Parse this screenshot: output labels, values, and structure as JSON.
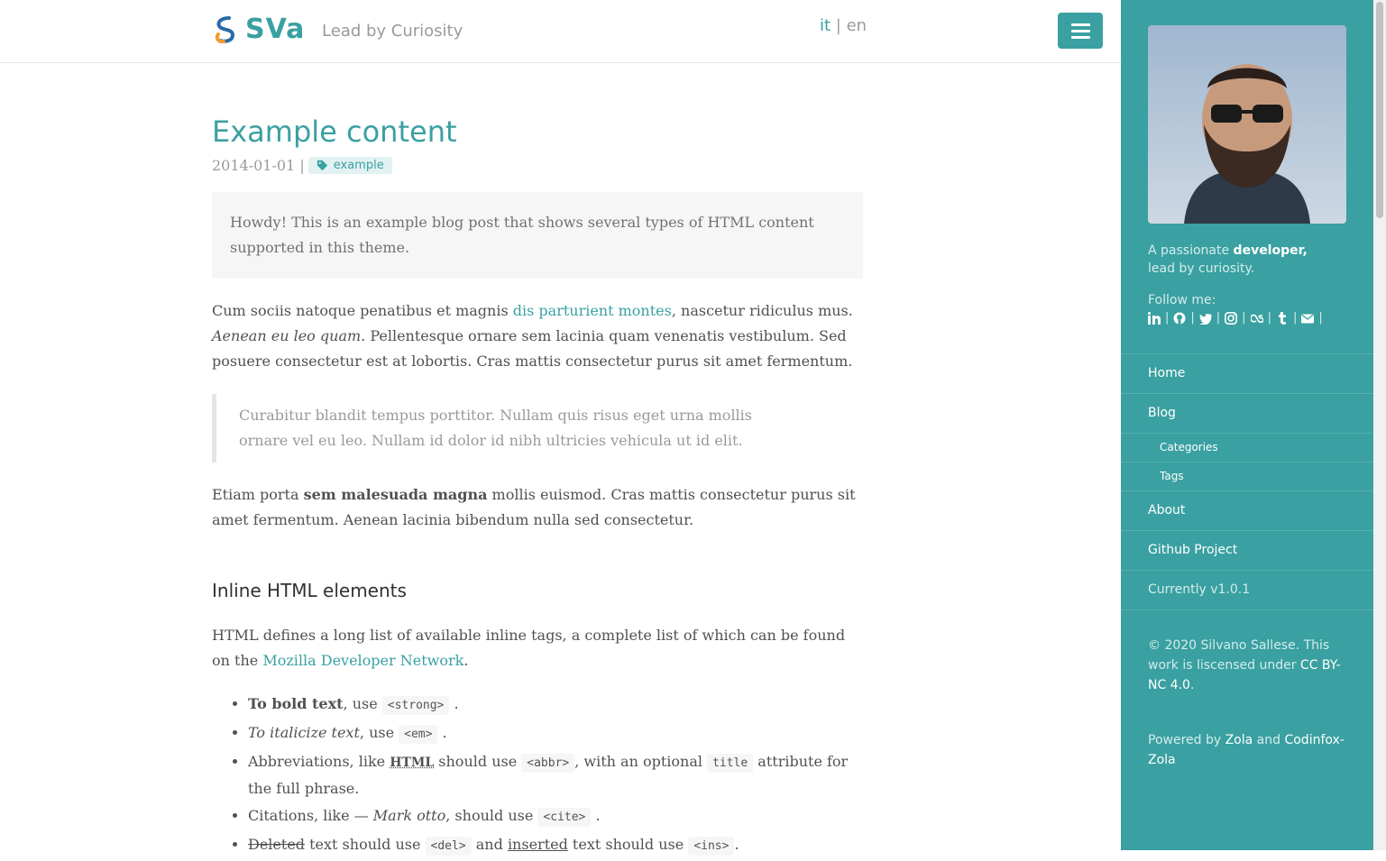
{
  "header": {
    "logo_text": "SVa",
    "tagline": "Lead by Curiosity",
    "lang_it": "it",
    "lang_sep": "|",
    "lang_en": "en"
  },
  "post": {
    "title": "Example content",
    "date": "2014-01-01",
    "meta_sep": "|",
    "tag": "example",
    "intro": "Howdy! This is an example blog post that shows several types of HTML content supported in this theme.",
    "p1_a": "Cum sociis natoque penatibus et magnis ",
    "p1_link": "dis parturient montes",
    "p1_b": ", nascetur ridiculus mus. ",
    "p1_em": "Aenean eu leo quam.",
    "p1_c": " Pellentesque ornare sem lacinia quam venenatis vestibulum. Sed posuere consectetur est at lobortis. Cras mattis consectetur purus sit amet fermentum.",
    "quote": "Curabitur blandit tempus porttitor. Nullam quis risus eget urna mollis ornare vel eu leo. Nullam id dolor id nibh ultricies vehicula ut id elit.",
    "p2_a": "Etiam porta ",
    "p2_strong": "sem malesuada magna",
    "p2_b": " mollis euismod. Cras mattis consectetur purus sit amet fermentum. Aenean lacinia bibendum nulla sed consectetur.",
    "h2": "Inline HTML elements",
    "p3_a": "HTML defines a long list of available inline tags, a complete list of which can be found on the ",
    "p3_link": "Mozilla Developer Network",
    "p3_b": ".",
    "li1_strong": "To bold text",
    "li1_a": ", use ",
    "li1_code": "<strong>",
    "li1_b": ".",
    "li2_em": "To italicize text",
    "li2_a": ", use ",
    "li2_code": "<em>",
    "li2_b": ".",
    "li3_a": "Abbreviations, like ",
    "li3_abbr": "HTML",
    "li3_b": " should use ",
    "li3_code1": "<abbr>",
    "li3_c": ", with an optional ",
    "li3_code2": "title",
    "li3_d": " attribute for the full phrase.",
    "li4_a": "Citations, like — ",
    "li4_em": "Mark otto",
    "li4_b": ", should use ",
    "li4_code": "<cite>",
    "li4_c": ".",
    "li5_del": "Deleted",
    "li5_a": " text should use ",
    "li5_code1": "<del>",
    "li5_b": " and ",
    "li5_ins": "inserted",
    "li5_c": " text should use ",
    "li5_code2": "<ins>",
    "li5_d": "."
  },
  "sidebar": {
    "bio_a": "A passionate ",
    "bio_strong": "developer,",
    "bio_b": "lead by curiosity.",
    "follow_label": "Follow me:",
    "social_icons": [
      "linkedin-icon",
      "github-icon",
      "twitter-icon",
      "instagram-icon",
      "lastfm-icon",
      "tumblr-icon",
      "envelope-icon"
    ],
    "nav": {
      "home": "Home",
      "blog": "Blog",
      "categories": "Categories",
      "tags": "Tags",
      "about": "About",
      "github": "Github Project",
      "version": "Currently v1.0.1"
    },
    "license_a": "© 2020 Silvano Sallese. This work is liscensed under ",
    "license_link": "CC BY-NC 4.0",
    "license_b": ".",
    "powered_a": "Powered by ",
    "powered_zola": "Zola",
    "powered_and": " and ",
    "powered_theme": "Codinfox-Zola"
  },
  "colors": {
    "accent": "#3aa0a1",
    "sidebar_text": "#d4ecec",
    "body_text": "#515151"
  }
}
